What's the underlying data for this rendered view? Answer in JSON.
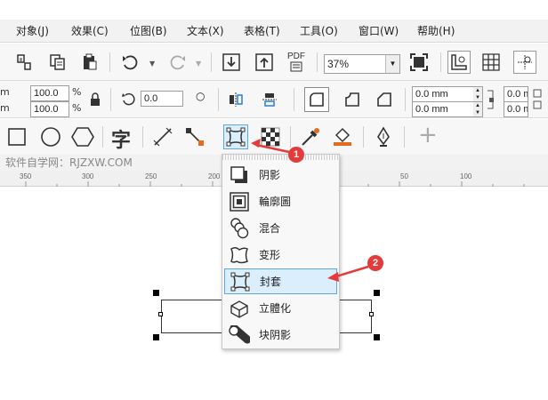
{
  "menu": [
    "对象(J)",
    "效果(C)",
    "位图(B)",
    "文本(X)",
    "表格(T)",
    "工具(O)",
    "窗口(W)",
    "帮助(H)"
  ],
  "toolbar": {
    "zoom_value": "37%",
    "pdf_label": "PDF"
  },
  "property_bar": {
    "w_label": "m",
    "h_label": "m",
    "scale_x": "100.0",
    "scale_y": "100.0",
    "percent": "%",
    "rotation": "0.0",
    "offset_x": "0.0 mm",
    "offset_y": "0.0 mm"
  },
  "tools": {
    "text_tool_glyph": "字",
    "plus_glyph": "+"
  },
  "watermark": "软件自学网：RJZXW.COM",
  "ruler": [
    "350",
    "300",
    "250",
    "200",
    "50",
    "100"
  ],
  "dropdown_items": [
    "阴影",
    "輪廓圖",
    "混合",
    "变形",
    "封套",
    "立體化",
    "块阴影"
  ],
  "selected_item": "封套",
  "badges": [
    "1",
    "2"
  ],
  "colors": {
    "accent": "#e33b3b",
    "selection": "#dbeefc",
    "selection_border": "#5fa8e8"
  }
}
